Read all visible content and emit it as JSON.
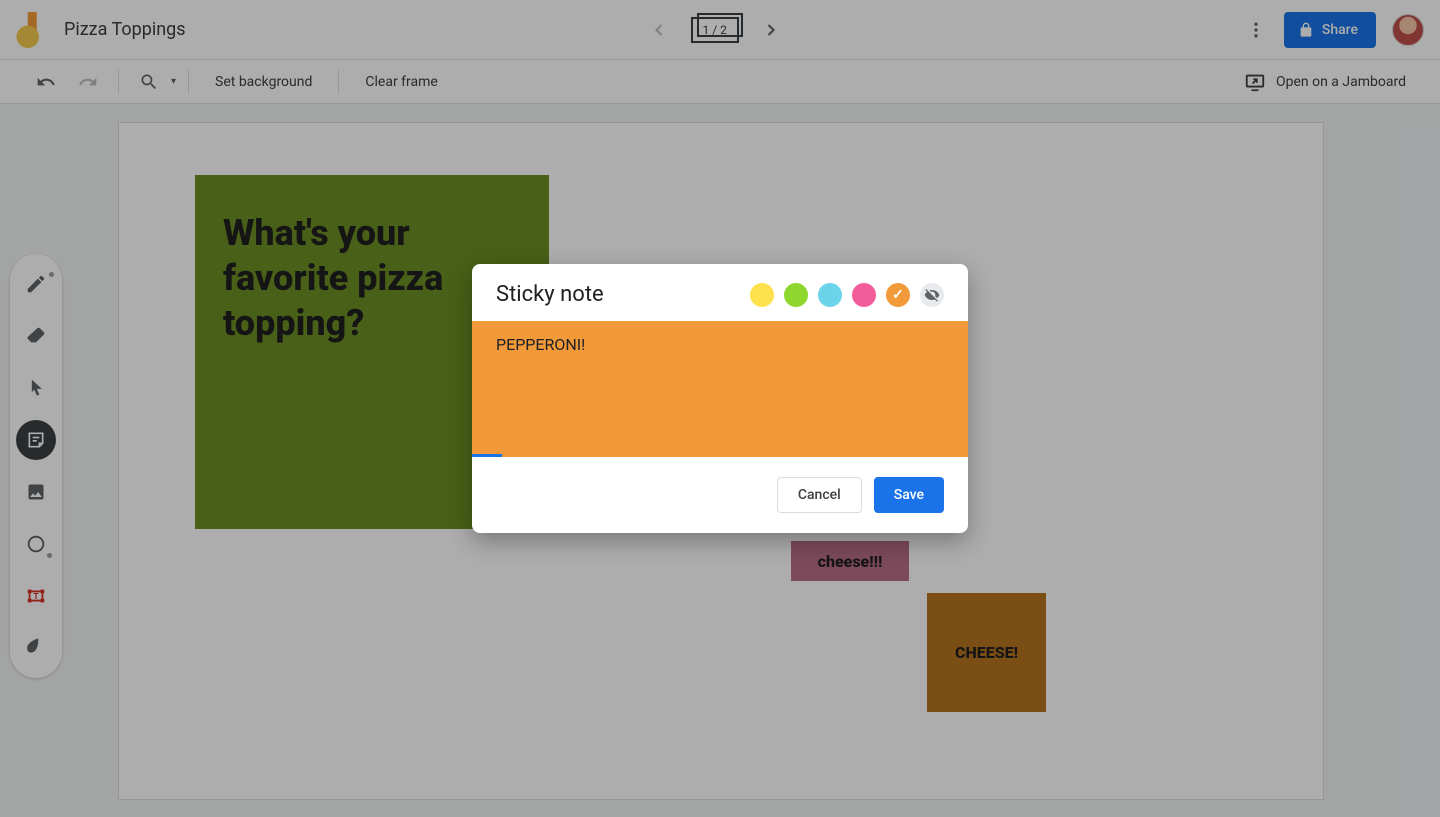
{
  "header": {
    "doc_title": "Pizza Toppings",
    "frame_counter": "1 / 2",
    "share_label": "Share"
  },
  "toolbar": {
    "set_background": "Set background",
    "clear_frame": "Clear frame",
    "open_jamboard": "Open on a Jamboard"
  },
  "canvas": {
    "big_note_text": "What's your favorite pizza topping?",
    "note_cheese1": "cheese!!!",
    "note_cheese2": "CHEESE!"
  },
  "dialog": {
    "title": "Sticky note",
    "input_value": "PEPPERONI!",
    "cancel_label": "Cancel",
    "save_label": "Save",
    "colors": {
      "yellow": "#ffe14d",
      "green": "#8fd62e",
      "blue": "#6bd4eb",
      "pink": "#f25c9b",
      "orange": "#f29a3a",
      "none": "#e8eaed"
    },
    "selected_color": "orange"
  },
  "side_tools": {
    "pen": "pen-tool",
    "eraser": "eraser-tool",
    "select": "select-tool",
    "sticky": "sticky-note-tool",
    "image": "image-tool",
    "shape": "shape-tool",
    "textbox": "textbox-tool",
    "laser": "laser-tool"
  }
}
